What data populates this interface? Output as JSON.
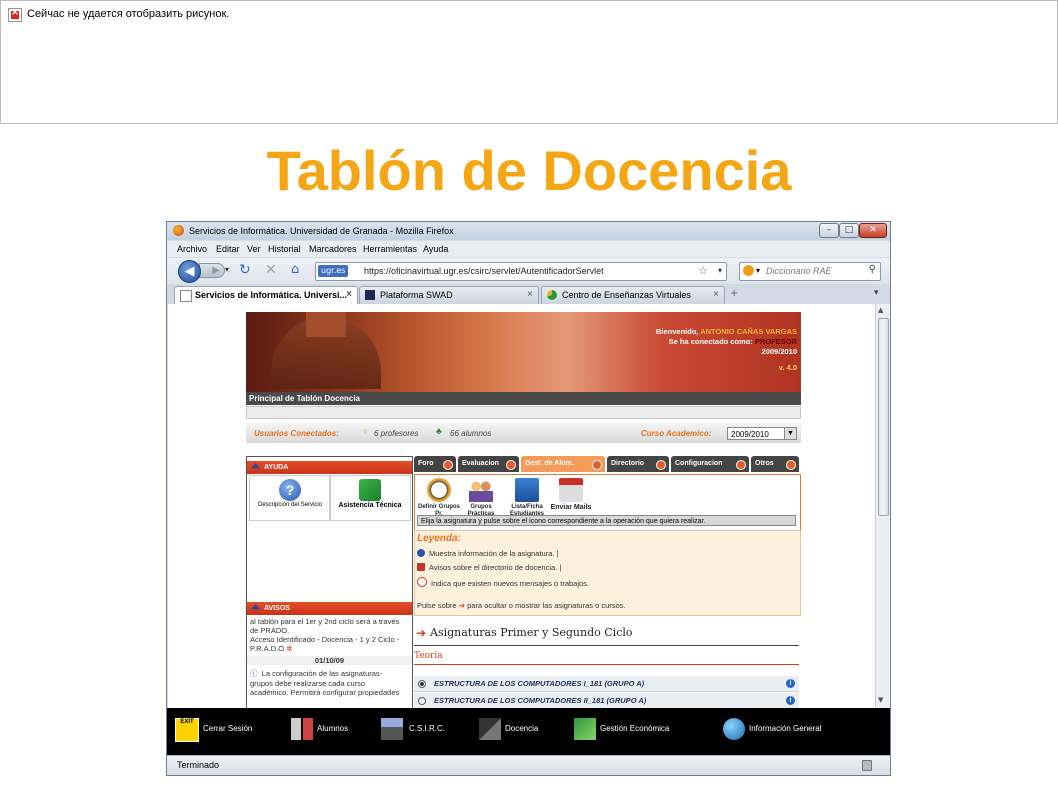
{
  "broken_image": {
    "alt": "Сейчас не удается отобразить рисунок."
  },
  "slide_title": "Tablón de Docencia",
  "window": {
    "title": "Servicios de Informática. Universidad de Granada - Mozilla Firefox",
    "menu": [
      "Archivo",
      "Editar",
      "Ver",
      "Historial",
      "Marcadores",
      "Herramientas",
      "Ayuda"
    ],
    "site_badge": "ugr.es",
    "url": "https://oficinavirtual.ugr.es/csirc/servlet/AutentificadorServlet",
    "search_placeholder": "Diccionario RAE",
    "tabs": [
      {
        "label": "Servicios de Informática. Universi...",
        "active": true
      },
      {
        "label": "Plataforma SWAD",
        "active": false
      },
      {
        "label": "Centro de Enseñanzas Virtuales",
        "active": false
      }
    ],
    "status": "Terminado"
  },
  "page": {
    "banner": {
      "welcome": "Bienvenido,",
      "user": "ANTONIO CAÑAS VARGAS",
      "connected_as": "Se ha conectado como:",
      "role": "PROFESOR",
      "year": "2009/2010",
      "version": "v. 4.0"
    },
    "title_bar": "Principal de Tablón Docencia",
    "users": {
      "label": "Usuarios Conectados:",
      "profesores": "6  profesores",
      "alumnos": "66  alumnos",
      "course_label": "Curso Academico:",
      "course_value": "2009/2010"
    },
    "ayuda": {
      "header": "AYUDA",
      "items": [
        "Descripción del Servicio",
        "Asistencia Técnica"
      ]
    },
    "avisos": {
      "header": "AVISOS",
      "line1": "al tablón para el 1er y 2nd ciclo será a través",
      "line2": "de PRADO.",
      "line3": "Acceso Identificado - Docencia - 1 y 2 Ciclo -",
      "line4": "P.R.A.D.O",
      "date": "01/10/09",
      "p1": "La configuración de las asignaturas-",
      "p2": "grupos debe realizarse cada curso",
      "p3": "académico. Permitirá configurar propiedades"
    },
    "menu_tabs": [
      "Foro",
      "Evaluacion",
      "Gest. de Alum.",
      "Directorio",
      "Configuracion",
      "Otros"
    ],
    "operations": [
      "Definir Grupos Pr.",
      "Grupos Prácticas",
      "Lista/Ficha Estudiantes",
      "Enviar Mails"
    ],
    "instruction": "Elija la asignatura y pulse sobre el icono correspondiente a la operación que quiera realizar.",
    "legend": {
      "title": "Leyenda:",
      "items": [
        "Muestra información de la asignatura. |",
        "Avisos sobre el directorio de docencia. |",
        "Indica que existen nuevos mensajes o trabajos."
      ],
      "toggle": "Pulse sobre",
      "toggle_rest": "para ocultar o mostrar las asignaturas o cursos."
    },
    "subjects": {
      "heading": "Asignaturas Primer y Segundo Ciclo",
      "section": "Teoria",
      "rows": [
        "ESTRUCTURA DE LOS COMPUTADORES I_181 (GRUPO A)",
        "ESTRUCTURA DE LOS COMPUTADORES II_181 (GRUPO A)"
      ]
    },
    "bottom_menu": [
      "Cerrar Sesión",
      "Alumnos",
      "C.S.I.R.C.",
      "Docencia",
      "Gestión Económica",
      "Información General"
    ],
    "exit_label": "EXIT"
  }
}
